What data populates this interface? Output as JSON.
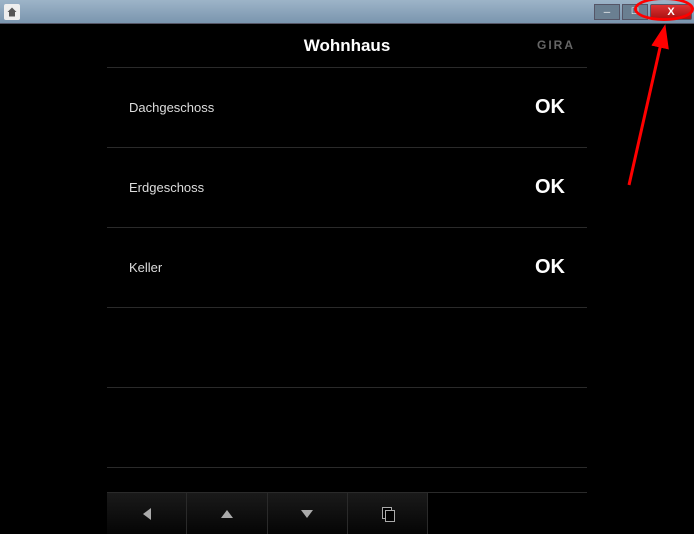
{
  "window": {
    "close_hint": "X"
  },
  "header": {
    "title": "Wohnhaus",
    "brand": "GIRA"
  },
  "rows": [
    {
      "label": "Dachgeschoss",
      "status": "OK"
    },
    {
      "label": "Erdgeschoss",
      "status": "OK"
    },
    {
      "label": "Keller",
      "status": "OK"
    },
    {
      "label": "",
      "status": ""
    },
    {
      "label": "",
      "status": ""
    }
  ]
}
